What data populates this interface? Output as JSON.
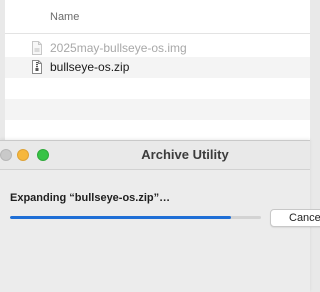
{
  "finder": {
    "column_header": "Name",
    "files": [
      {
        "name": "2025may-bullseye-os.img",
        "state": "dimmed",
        "icon": "document-icon"
      },
      {
        "name": "bullseye-os.zip",
        "state": "normal",
        "icon": "zip-archive-icon"
      }
    ]
  },
  "dialog": {
    "title": "Archive Utility",
    "status": "Expanding “bullseye-os.zip”…",
    "progress": 0.88,
    "cancel_label": "Cancel",
    "window_controls": [
      "close",
      "minimize",
      "maximize"
    ]
  },
  "colors": {
    "accent": "#1f6fd6",
    "close": "#c9c9c9",
    "minimize": "#f6b73c",
    "maximize": "#36c345"
  }
}
